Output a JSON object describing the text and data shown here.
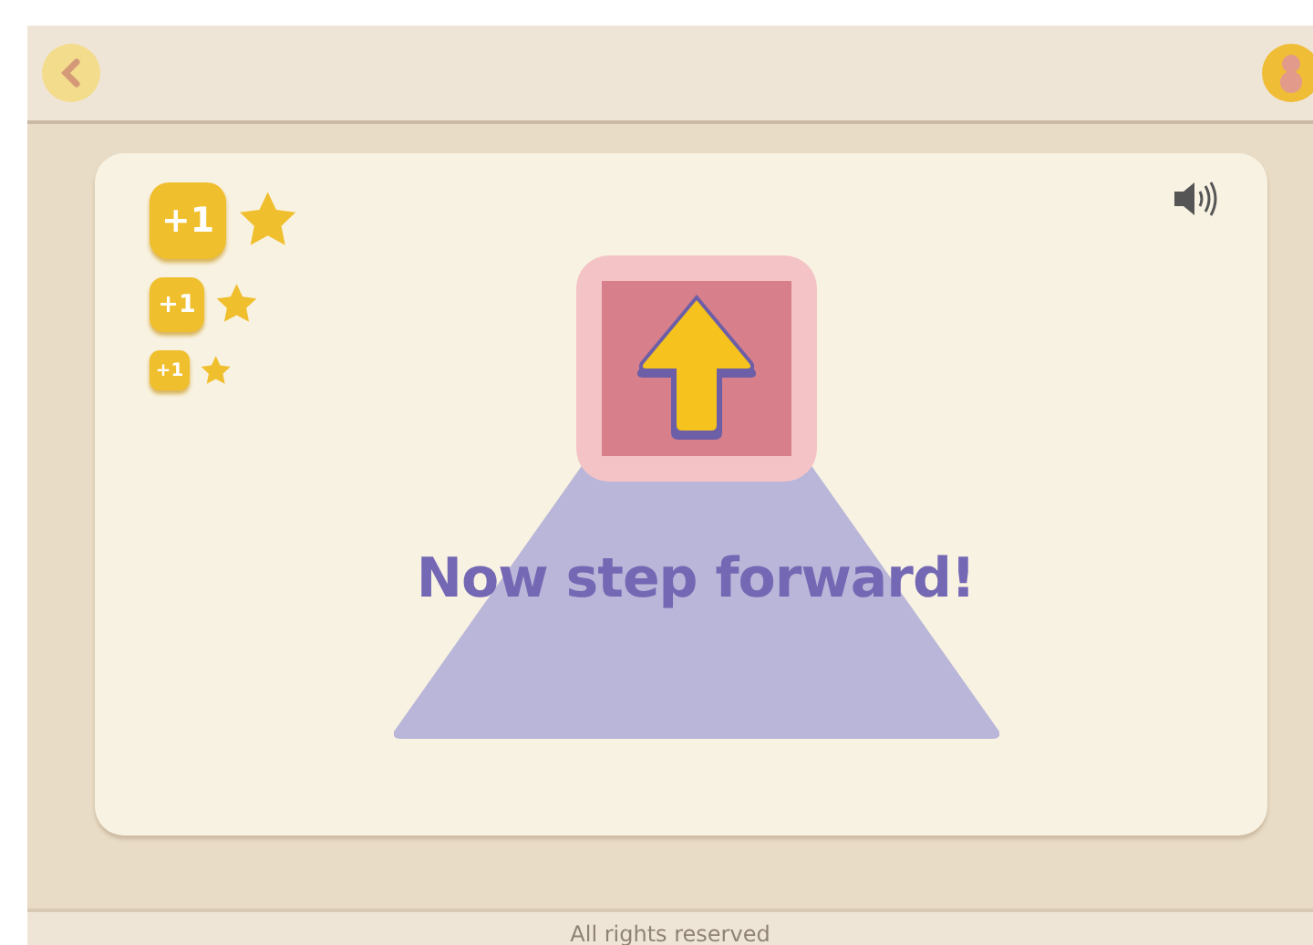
{
  "points": [
    {
      "label": "+1"
    },
    {
      "label": "+1"
    },
    {
      "label": "+1"
    }
  ],
  "prompt": {
    "text": "Now step forward!"
  },
  "footer": {
    "text": "All rights reserved"
  }
}
